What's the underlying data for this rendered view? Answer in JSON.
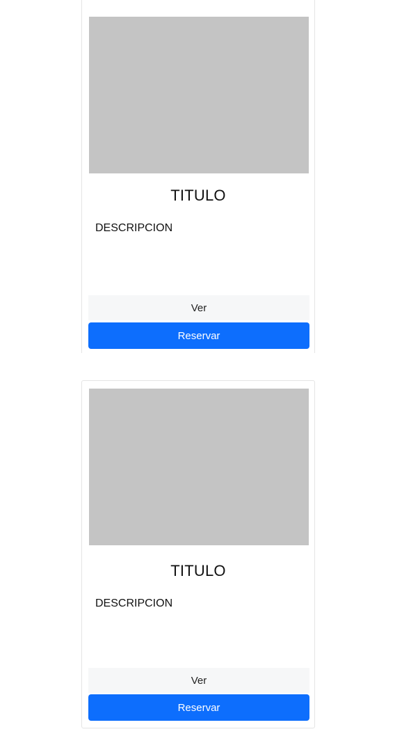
{
  "cards": [
    {
      "title": "TITULO",
      "description": "DESCRIPCION",
      "view_label": "Ver",
      "reserve_label": "Reservar"
    },
    {
      "title": "TITULO",
      "description": "DESCRIPCION",
      "view_label": "Ver",
      "reserve_label": "Reservar"
    }
  ],
  "colors": {
    "image_placeholder": "#c4c4c4",
    "primary_button": "#0d6efd",
    "secondary_button": "#f6f7f8"
  }
}
